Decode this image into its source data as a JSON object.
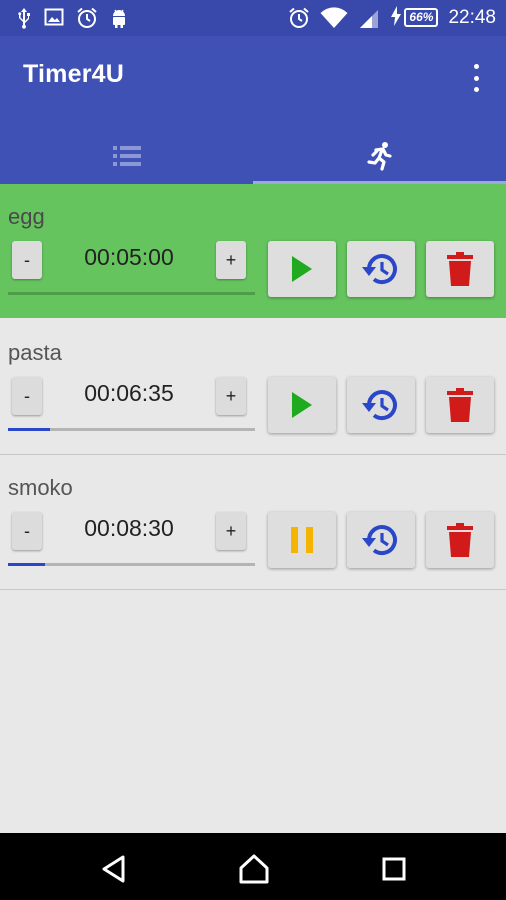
{
  "status_bar": {
    "left_icons": [
      "usb-icon",
      "image-icon",
      "alarm-icon",
      "android-icon"
    ],
    "right_icons": [
      "alarm-icon",
      "wifi-icon",
      "signal-icon",
      "charging-icon"
    ],
    "battery": "66%",
    "time": "22:48"
  },
  "app_bar": {
    "title": "Timer4U",
    "menu_icon": "more-vert-icon",
    "tabs": [
      {
        "icon": "list-icon",
        "selected": false
      },
      {
        "icon": "running-icon",
        "selected": true
      }
    ]
  },
  "timers": [
    {
      "name": "egg",
      "time": "00:05:00",
      "minus": "-",
      "plus": "+",
      "progress": 0.0,
      "state": "stopped",
      "highlighted": true
    },
    {
      "name": "pasta",
      "time": "00:06:35",
      "minus": "-",
      "plus": "+",
      "progress": 0.17,
      "state": "stopped",
      "highlighted": false
    },
    {
      "name": "smoko",
      "time": "00:08:30",
      "minus": "-",
      "plus": "+",
      "progress": 0.15,
      "state": "running",
      "highlighted": false
    }
  ],
  "colors": {
    "primary": "#3f51b5",
    "status_bar": "#3949ab",
    "active_row": "#66c45f",
    "play": "#1faa1f",
    "pause": "#f5b400",
    "reset": "#2a47c9",
    "delete": "#d11a1a",
    "progress": "#2a47c9"
  },
  "nav_bar": {
    "icons": [
      "back-icon",
      "home-icon",
      "recents-icon"
    ]
  }
}
